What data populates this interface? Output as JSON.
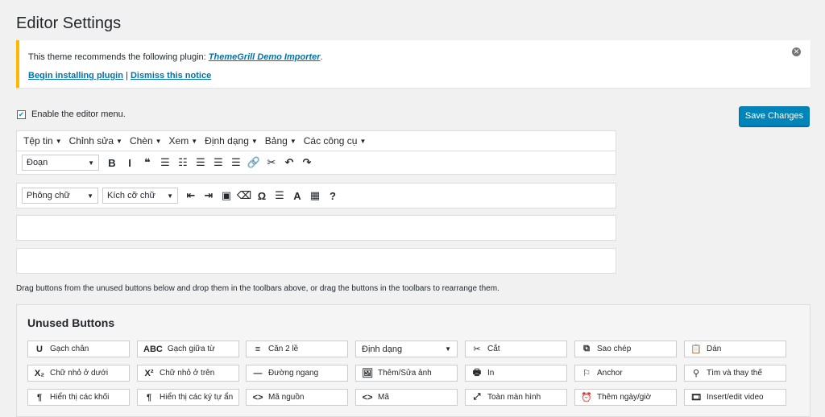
{
  "page": {
    "title": "Editor Settings"
  },
  "notice": {
    "prefix": "This theme recommends the following plugin: ",
    "plugin_name": "ThemeGrill Demo Importer",
    "suffix": ".",
    "install_link": "Begin installing plugin",
    "separator": " | ",
    "dismiss_link": "Dismiss this notice",
    "close_glyph": "✕"
  },
  "settings": {
    "enable_menu_label": "Enable the editor menu.",
    "enable_menu_checked": true,
    "save_label": "Save Changes"
  },
  "menubar": [
    "Tệp tin",
    "Chỉnh sửa",
    "Chèn",
    "Xem",
    "Định dạng",
    "Bảng",
    "Các công cụ"
  ],
  "toolbar1": {
    "format_select": "Đoạn",
    "icons": [
      {
        "name": "bold-icon",
        "glyph": "B"
      },
      {
        "name": "italic-icon",
        "glyph": "I"
      },
      {
        "name": "blockquote-icon",
        "glyph": "❝"
      },
      {
        "name": "bullet-list-icon",
        "glyph": "☰"
      },
      {
        "name": "numbered-list-icon",
        "glyph": "☷"
      },
      {
        "name": "align-left-icon",
        "glyph": "☰"
      },
      {
        "name": "align-center-icon",
        "glyph": "☰"
      },
      {
        "name": "align-right-icon",
        "glyph": "☰"
      },
      {
        "name": "link-icon",
        "glyph": "🔗"
      },
      {
        "name": "unlink-icon",
        "glyph": "✂"
      },
      {
        "name": "undo-icon",
        "glyph": "↶"
      },
      {
        "name": "redo-icon",
        "glyph": "↷"
      }
    ]
  },
  "toolbar2": {
    "font_select": "Phông chữ",
    "size_select": "Kích cỡ chữ",
    "icons": [
      {
        "name": "outdent-icon",
        "glyph": "⇤"
      },
      {
        "name": "indent-icon",
        "glyph": "⇥"
      },
      {
        "name": "paste-text-icon",
        "glyph": "▣"
      },
      {
        "name": "clear-formatting-icon",
        "glyph": "⌫"
      },
      {
        "name": "special-character-icon",
        "glyph": "Ω"
      },
      {
        "name": "page-break-icon",
        "glyph": "☰"
      },
      {
        "name": "text-color-icon",
        "glyph": "A"
      },
      {
        "name": "table-icon",
        "glyph": "▦"
      },
      {
        "name": "help-icon",
        "glyph": "?"
      }
    ]
  },
  "help_text": "Drag buttons from the unused buttons below and drop them in the toolbars above, or drag the buttons in the toolbars to rearrange them.",
  "unused": {
    "title": "Unused Buttons",
    "buttons": [
      {
        "icon": "U",
        "icon_name": "underline-icon",
        "label": "Gạch chân"
      },
      {
        "icon": "ABC",
        "icon_name": "strikethrough-icon",
        "label": "Gạch giữa từ"
      },
      {
        "icon": "≡",
        "icon_name": "justify-icon",
        "label": "Căn 2 lề"
      },
      {
        "icon": "",
        "icon_name": "",
        "label": "Định dạng",
        "select": true
      },
      {
        "icon": "✂",
        "icon_name": "cut-icon",
        "label": "Cắt"
      },
      {
        "icon": "⧉",
        "icon_name": "copy-icon",
        "label": "Sao chép"
      },
      {
        "icon": "📋",
        "icon_name": "paste-icon",
        "label": "Dán"
      },
      {
        "icon": "X₂",
        "icon_name": "subscript-icon",
        "label": "Chữ nhỏ ở dưới"
      },
      {
        "icon": "X²",
        "icon_name": "superscript-icon",
        "label": "Chữ nhỏ ở trên"
      },
      {
        "icon": "—",
        "icon_name": "horizontal-line-icon",
        "label": "Đường ngang"
      },
      {
        "icon": "🖼",
        "icon_name": "image-icon",
        "label": "Thêm/Sửa ảnh"
      },
      {
        "icon": "🖶",
        "icon_name": "print-icon",
        "label": "In"
      },
      {
        "icon": "⚐",
        "icon_name": "anchor-icon",
        "label": "Anchor"
      },
      {
        "icon": "⚲",
        "icon_name": "find-replace-icon",
        "label": "Tìm và thay thế"
      },
      {
        "icon": "¶",
        "icon_name": "show-blocks-icon",
        "label": "Hiển thị các khối"
      },
      {
        "icon": "¶",
        "icon_name": "show-invisibles-icon",
        "label": "Hiển thị các ký tự ẩn"
      },
      {
        "icon": "<>",
        "icon_name": "source-code-icon",
        "label": "Mã nguồn"
      },
      {
        "icon": "<>",
        "icon_name": "code-icon",
        "label": "Mã"
      },
      {
        "icon": "⤢",
        "icon_name": "fullscreen-icon",
        "label": "Toàn màn hình"
      },
      {
        "icon": "⏰",
        "icon_name": "datetime-icon",
        "label": "Thêm ngày/giờ"
      },
      {
        "icon": "🎞",
        "icon_name": "video-icon",
        "label": "Insert/edit video"
      }
    ]
  }
}
